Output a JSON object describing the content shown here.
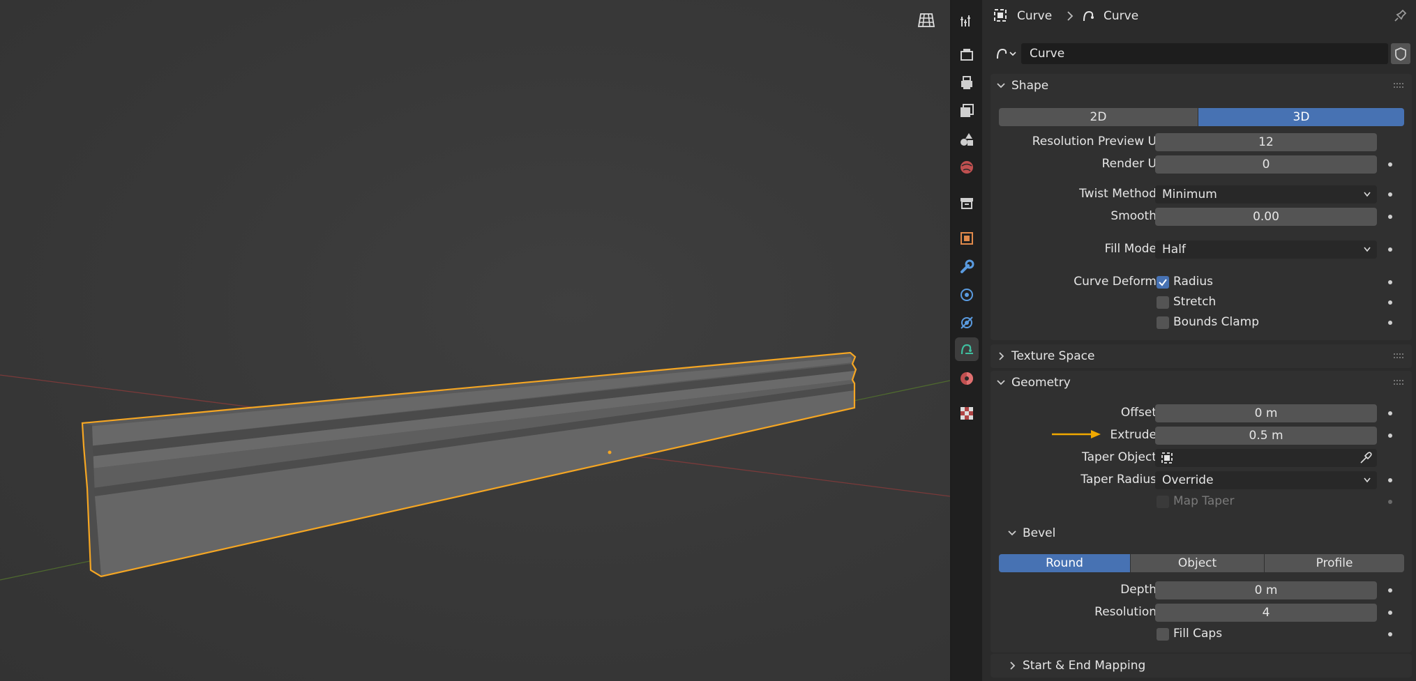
{
  "breadcrumb": {
    "object_name": "Curve",
    "data_name": "Curve"
  },
  "datablock": {
    "name": "Curve"
  },
  "shape": {
    "title": "Shape",
    "dim_2d": "2D",
    "dim_3d": "3D",
    "resolution_preview_u_label": "Resolution Preview U",
    "resolution_preview_u_value": "12",
    "render_u_label": "Render U",
    "render_u_value": "0",
    "twist_method_label": "Twist Method",
    "twist_method_value": "Minimum",
    "smooth_label": "Smooth",
    "smooth_value": "0.00",
    "fill_mode_label": "Fill Mode",
    "fill_mode_value": "Half",
    "curve_deform_label": "Curve Deform",
    "radius_label": "Radius",
    "stretch_label": "Stretch",
    "bounds_clamp_label": "Bounds Clamp"
  },
  "texture_space": {
    "title": "Texture Space"
  },
  "geometry": {
    "title": "Geometry",
    "offset_label": "Offset",
    "offset_value": "0 m",
    "extrude_label": "Extrude",
    "extrude_value": "0.5 m",
    "taper_object_label": "Taper Object",
    "taper_radius_label": "Taper Radius",
    "taper_radius_value": "Override",
    "map_taper_label": "Map Taper"
  },
  "bevel": {
    "title": "Bevel",
    "mode_round": "Round",
    "mode_object": "Object",
    "mode_profile": "Profile",
    "depth_label": "Depth",
    "depth_value": "0 m",
    "resolution_label": "Resolution",
    "resolution_value": "4",
    "fill_caps_label": "Fill Caps"
  },
  "start_end_mapping": {
    "title": "Start & End Mapping"
  },
  "colors": {
    "accent": "#4772b3",
    "selection": "#f5a623",
    "annotation_arrow": "#f0a800"
  },
  "icons": [
    "grid-view-icon",
    "tool-icon",
    "render-icon",
    "output-icon",
    "view-layer-icon",
    "scene-icon",
    "world-icon",
    "collection-icon",
    "object-icon",
    "modifier-icon",
    "particles-icon",
    "physics-icon",
    "curve-data-icon",
    "material-icon",
    "texture-icon"
  ]
}
